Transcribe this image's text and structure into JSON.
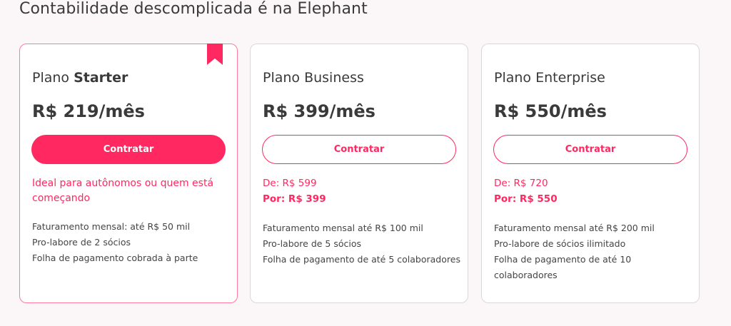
{
  "heading": "Contabilidade descomplicada é na Elephant",
  "colors": {
    "accent": "#ff2860",
    "background": "#fbf7f8",
    "card": "#ffffff"
  },
  "plans": [
    {
      "title_prefix": "Plano ",
      "title_bold": "Starter",
      "price": "R$ 219/mês",
      "button_label": "Contratar",
      "featured": true,
      "tagline": "Ideal para autônomos ou quem está começando",
      "features": [
        "Faturamento mensal: até R$ 50 mil",
        "Pro-labore de 2 sócios",
        "Folha de pagamento cobrada à parte"
      ]
    },
    {
      "title": "Plano Business",
      "price": "R$ 399/mês",
      "button_label": "Contratar",
      "old_price": "De: R$ 599",
      "new_price": "Por: R$ 399",
      "features": [
        "Faturamento mensal até R$ 100 mil",
        "Pro-labore de 5 sócios",
        "Folha de pagamento de até 5 colaboradores"
      ]
    },
    {
      "title": "Plano Enterprise",
      "price": "R$ 550/mês",
      "button_label": "Contratar",
      "old_price": "De: R$ 720",
      "new_price": "Por: R$ 550",
      "features": [
        "Faturamento mensal até R$ 200 mil",
        "Pro-labore de sócios ilimitado",
        "Folha de pagamento de até 10 colaboradores"
      ]
    }
  ],
  "icons": {
    "featured_marker": "bookmark-icon"
  }
}
